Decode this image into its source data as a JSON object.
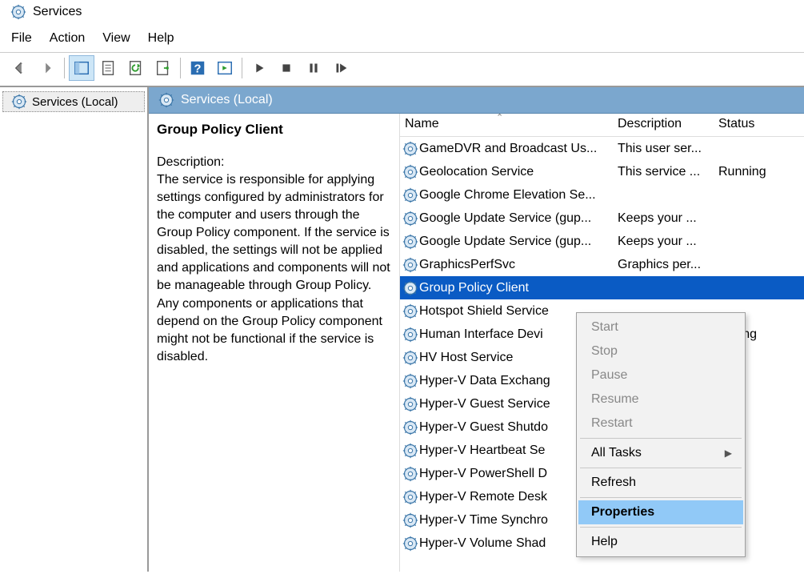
{
  "window": {
    "title": "Services"
  },
  "menu": {
    "file": "File",
    "action": "Action",
    "view": "View",
    "help": "Help"
  },
  "tree": {
    "root": "Services (Local)"
  },
  "pane": {
    "header": "Services (Local)"
  },
  "detail": {
    "title": "Group Policy Client",
    "desc_label": "Description:",
    "desc": "The service is responsible for applying settings configured by administrators for the computer and users through the Group Policy component. If the service is disabled, the settings will not be applied and applications and components will not be manageable through Group Policy. Any components or applications that depend on the Group Policy component might not be functional if the service is disabled."
  },
  "columns": {
    "name": "Name",
    "description": "Description",
    "status": "Status"
  },
  "services": [
    {
      "name": "GameDVR and Broadcast Us...",
      "desc": "This user ser...",
      "status": ""
    },
    {
      "name": "Geolocation Service",
      "desc": "This service ...",
      "status": "Running"
    },
    {
      "name": "Google Chrome Elevation Se...",
      "desc": "",
      "status": ""
    },
    {
      "name": "Google Update Service (gup...",
      "desc": "Keeps your ...",
      "status": ""
    },
    {
      "name": "Google Update Service (gup...",
      "desc": "Keeps your ...",
      "status": ""
    },
    {
      "name": "GraphicsPerfSvc",
      "desc": "Graphics per...",
      "status": ""
    },
    {
      "name": "Group Policy Client",
      "desc": "",
      "status": "",
      "selected": true
    },
    {
      "name": "Hotspot Shield Service",
      "desc": "",
      "status": ""
    },
    {
      "name": "Human Interface Devi",
      "desc": "",
      "status": "unning"
    },
    {
      "name": "HV Host Service",
      "desc": "",
      "status": ""
    },
    {
      "name": "Hyper-V Data Exchang",
      "desc": "",
      "status": ""
    },
    {
      "name": "Hyper-V Guest Service",
      "desc": "",
      "status": ""
    },
    {
      "name": "Hyper-V Guest Shutdo",
      "desc": "",
      "status": ""
    },
    {
      "name": "Hyper-V Heartbeat Se",
      "desc": "",
      "status": ""
    },
    {
      "name": "Hyper-V PowerShell D",
      "desc": "",
      "status": ""
    },
    {
      "name": "Hyper-V Remote Desk",
      "desc": "",
      "status": ""
    },
    {
      "name": "Hyper-V Time Synchro",
      "desc": "",
      "status": ""
    },
    {
      "name": "Hyper-V Volume Shad",
      "desc": "",
      "status": ""
    }
  ],
  "context_menu": {
    "start": "Start",
    "stop": "Stop",
    "pause": "Pause",
    "resume": "Resume",
    "restart": "Restart",
    "all_tasks": "All Tasks",
    "refresh": "Refresh",
    "properties": "Properties",
    "help": "Help"
  }
}
